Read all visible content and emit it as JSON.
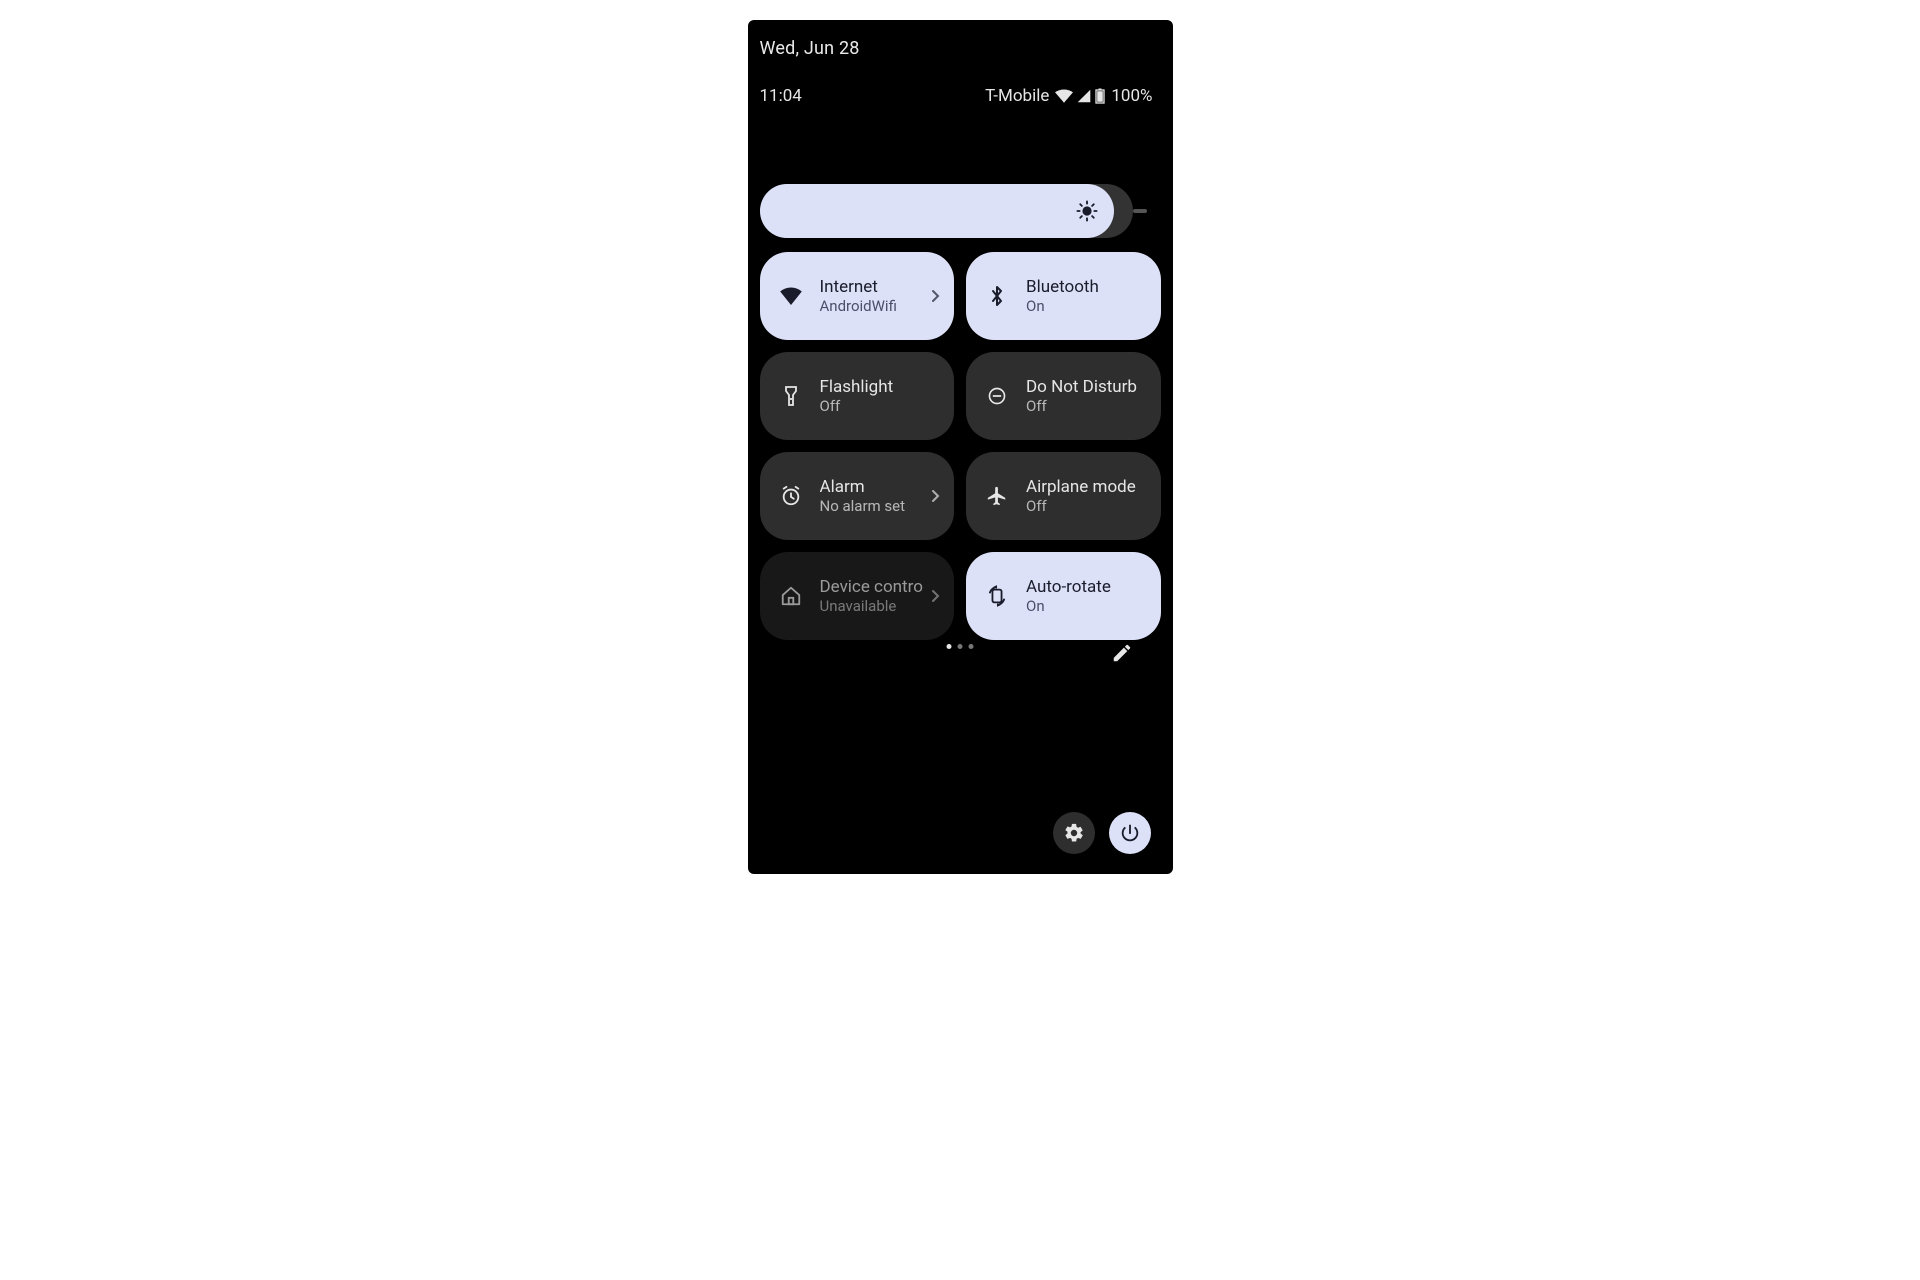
{
  "date": "Wed, Jun 28",
  "time": "11:04",
  "carrier": "T-Mobile",
  "battery_percent": "100%",
  "brightness": {
    "level_percent": 95
  },
  "tiles": [
    {
      "title": "Internet",
      "sub": "AndroidWifi",
      "icon": "wifi-icon",
      "state": "on",
      "chevron": true
    },
    {
      "title": "Bluetooth",
      "sub": "On",
      "icon": "bluetooth-icon",
      "state": "on",
      "chevron": false
    },
    {
      "title": "Flashlight",
      "sub": "Off",
      "icon": "flashlight-icon",
      "state": "off",
      "chevron": false
    },
    {
      "title": "Do Not Disturb",
      "sub": "Off",
      "icon": "dnd-icon",
      "state": "off",
      "chevron": false
    },
    {
      "title": "Alarm",
      "sub": "No alarm set",
      "icon": "alarm-icon",
      "state": "off",
      "chevron": true
    },
    {
      "title": "Airplane mode",
      "sub": "Off",
      "icon": "airplane-icon",
      "state": "off",
      "chevron": false
    },
    {
      "title": "Device contro",
      "sub": "Unavailable",
      "icon": "home-icon",
      "state": "disabled",
      "chevron": true
    },
    {
      "title": "Auto-rotate",
      "sub": "On",
      "icon": "autorotate-icon",
      "state": "on",
      "chevron": false
    }
  ],
  "pager": {
    "pages": 3,
    "active": 0
  }
}
